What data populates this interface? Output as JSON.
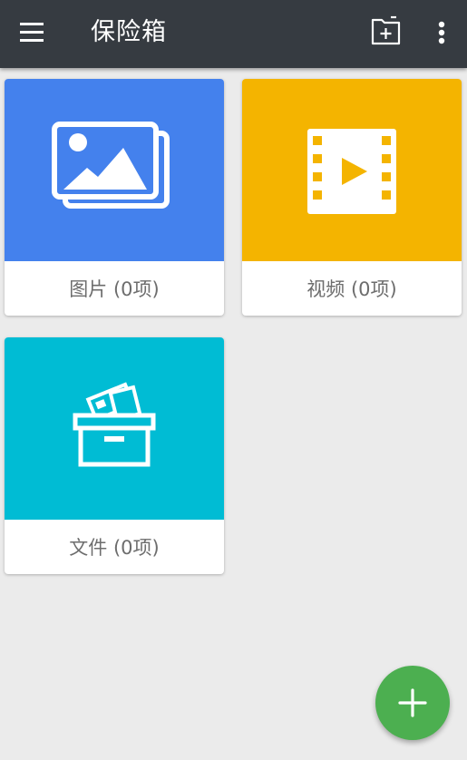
{
  "app_bar": {
    "title": "保险箱",
    "icons": {
      "menu": "hamburger-menu-icon",
      "new_folder": "add-folder-icon",
      "more": "more-vertical-icon"
    }
  },
  "vault_items": [
    {
      "id": "photos",
      "label": "图片 (0项)",
      "color": "#4481ed",
      "icon": "photos-icon"
    },
    {
      "id": "videos",
      "label": "视频 (0项)",
      "color": "#f4b400",
      "icon": "video-icon"
    },
    {
      "id": "files",
      "label": "文件 (0项)",
      "color": "#00bcd4",
      "icon": "file-box-icon"
    }
  ],
  "fab": {
    "icon": "plus-icon",
    "color": "#4caf50"
  },
  "colors": {
    "app_bar": "#363b41",
    "background": "#ebebeb"
  }
}
